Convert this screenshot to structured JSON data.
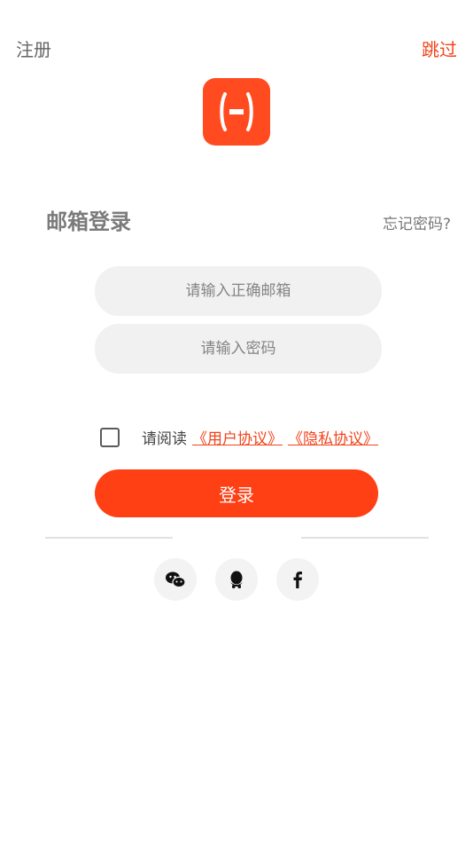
{
  "header": {
    "register_label": "注册",
    "skip_label": "跳过"
  },
  "login": {
    "title": "邮箱登录",
    "forgot_label": "忘记密码?",
    "email_placeholder": "请输入正确邮箱",
    "password_placeholder": "请输入密码",
    "agree_prefix": "请阅读",
    "user_agreement": "《用户协议》",
    "privacy_agreement": "《隐私协议》",
    "submit_label": "登录"
  },
  "social": {
    "icons": [
      "wechat-icon",
      "qq-icon",
      "facebook-icon"
    ]
  },
  "colors": {
    "accent": "#ff3f14",
    "link": "#f2431b",
    "input_bg": "#f1f1f1"
  }
}
